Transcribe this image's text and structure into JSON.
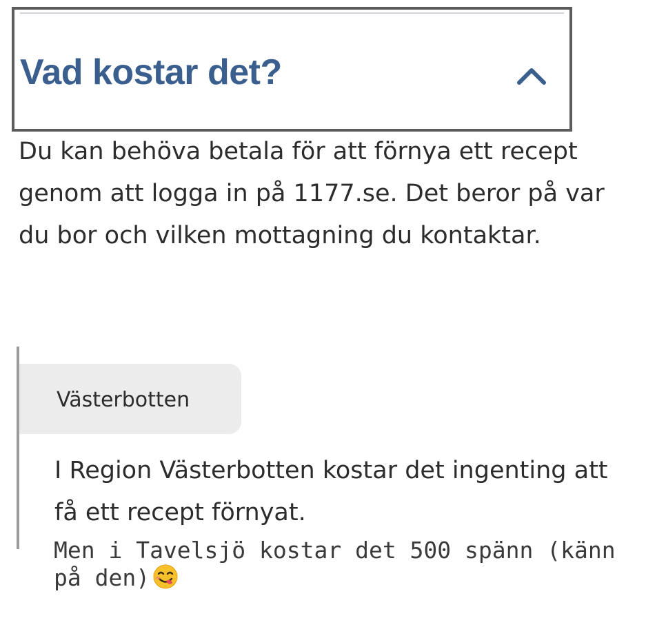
{
  "accordion": {
    "title": "Vad kostar det?",
    "toggle_icon": "chevron-up-icon",
    "expanded": true,
    "title_color": "#3a5f8e"
  },
  "intro": {
    "text": "Du kan behöva betala för att förnya ett recept genom att logga in på 1177.se. Det beror på var du bor och vilken mottagning du kontaktar."
  },
  "region": {
    "tag_label": "Västerbotten",
    "text": "I Region Västerbotten kostar det ingenting att få ett recept förnyat."
  },
  "comment": {
    "text": "Men i Tavelsjö kostar det 500 spänn (känn på den)",
    "emoji_icon": "face-savoring-food-emoji"
  }
}
